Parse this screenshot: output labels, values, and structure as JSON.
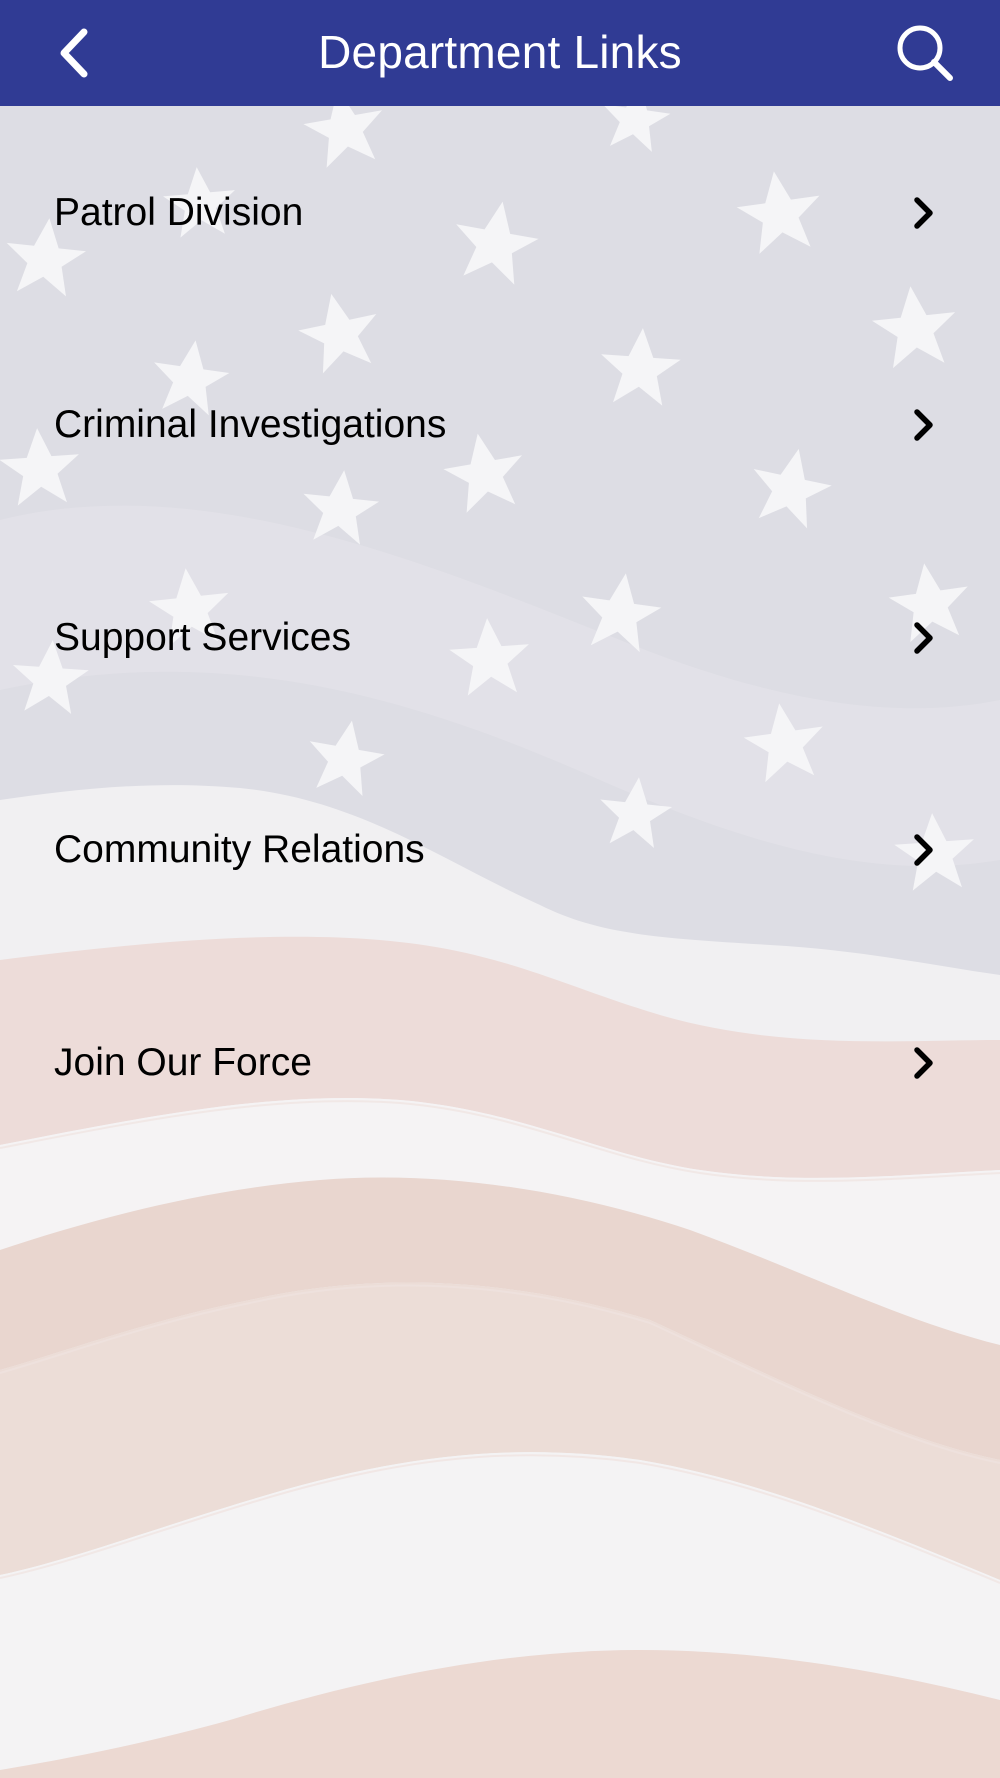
{
  "header": {
    "title": "Department Links",
    "back_icon": "chevron-left-icon",
    "search_icon": "search-icon",
    "background_color": "#303b94",
    "text_color": "#ffffff"
  },
  "menu": {
    "items": [
      {
        "label": "Patrol Division",
        "icon": "chevron-right-icon"
      },
      {
        "label": "Criminal Investigations",
        "icon": "chevron-right-icon"
      },
      {
        "label": "Support Services",
        "icon": "chevron-right-icon"
      },
      {
        "label": "Community Relations",
        "icon": "chevron-right-icon"
      },
      {
        "label": "Join Our Force",
        "icon": "chevron-right-icon"
      }
    ]
  },
  "background": {
    "image": "american-flag-faded",
    "colors": {
      "field": "#dcdce4",
      "stripe_red": "#e8d3cc",
      "stripe_white": "#f3f2f3",
      "star": "#f5f5f7"
    }
  }
}
